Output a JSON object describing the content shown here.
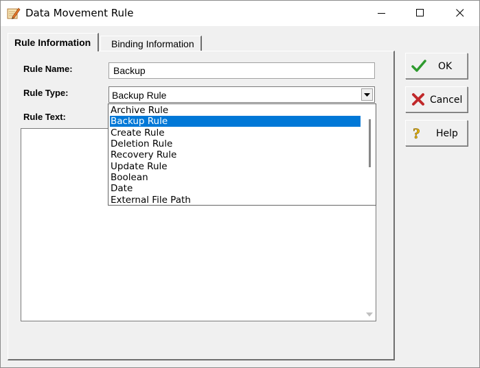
{
  "window": {
    "title": "Data Movement Rule",
    "app_icon": "pencil-notepad-icon"
  },
  "titlebar_controls": [
    "minimize-icon",
    "maximize-icon",
    "close-icon"
  ],
  "tabs": [
    {
      "label": "Rule Information",
      "active": true
    },
    {
      "label": "Binding Information",
      "active": false
    }
  ],
  "form": {
    "rule_name_label": "Rule Name:",
    "rule_name_value": "Backup",
    "rule_type_label": "Rule Type:",
    "rule_type_value": "Backup Rule",
    "rule_text_label": "Rule Text:",
    "rule_text_value": ""
  },
  "rule_type_options": [
    "Archive Rule",
    "Backup Rule",
    "Create Rule",
    "Deletion Rule",
    "Recovery Rule",
    "Update Rule",
    "Boolean",
    "Date",
    "External File Path"
  ],
  "rule_type_selected_index": 1,
  "buttons": {
    "ok": {
      "label": "OK",
      "icon": "checkmark-icon"
    },
    "cancel": {
      "label": "Cancel",
      "icon": "red-x-icon"
    },
    "help": {
      "label": "Help",
      "icon": "question-mark-icon"
    }
  },
  "colors": {
    "selection": "#0078d7",
    "ok_check": "#2e9a2e",
    "cancel_x": "#c0282a",
    "help_q": "#e8b400"
  }
}
